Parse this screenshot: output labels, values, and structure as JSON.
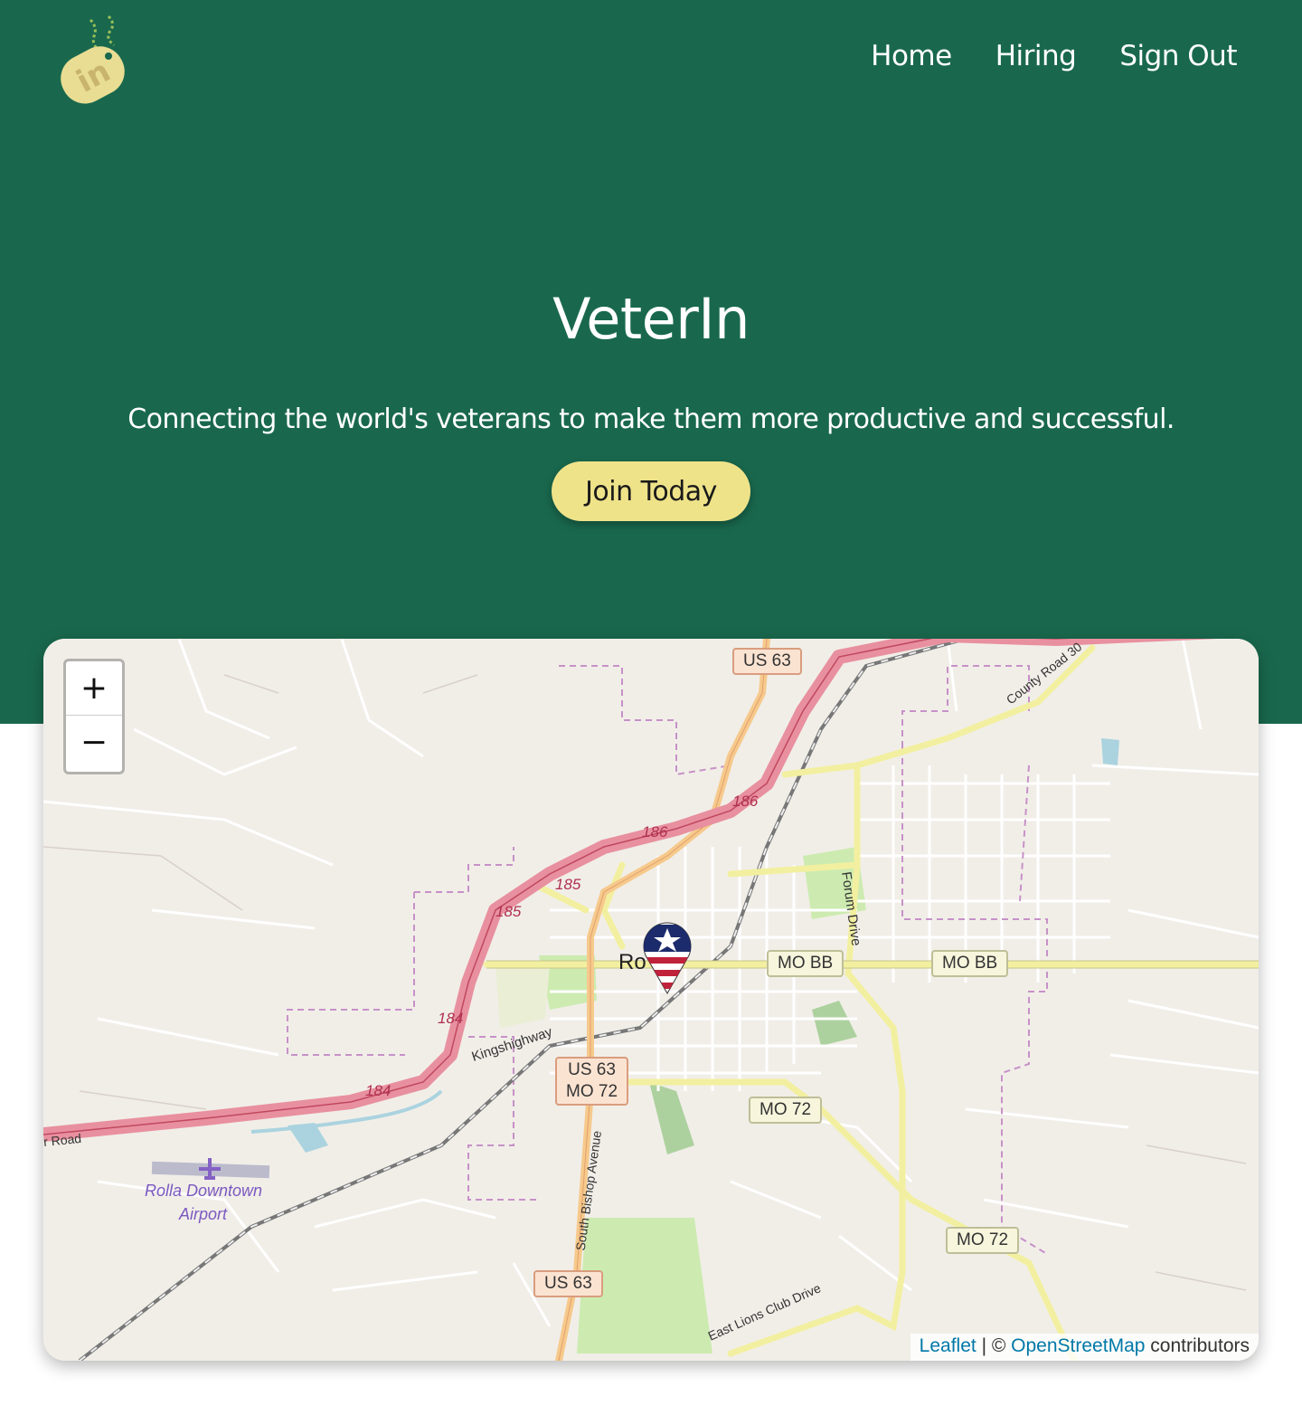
{
  "header": {
    "logo_icon": "dog-tag-logo-icon",
    "nav": [
      {
        "label": "Home"
      },
      {
        "label": "Hiring"
      },
      {
        "label": "Sign Out"
      }
    ]
  },
  "hero": {
    "title": "VeterIn",
    "tagline": "Connecting the world's veterans to make them more productive and successful.",
    "cta_label": "Join Today"
  },
  "colors": {
    "hero_bg": "#19684d",
    "cta_bg": "#efe38a",
    "map_bg": "#f1eee8",
    "highway": "#e8909f",
    "primary_road": "#f6c98c",
    "secondary_road": "#f2f0a0",
    "link": "#0078a8"
  },
  "map": {
    "zoom_in_label": "+",
    "zoom_out_label": "−",
    "marker_icon": "american-flag-pin-icon",
    "airport_icon": "airplane-icon",
    "attribution": {
      "leaflet": "Leaflet",
      "separator": " | © ",
      "osm": "OpenStreetMap",
      "suffix": " contributors"
    },
    "shields": [
      {
        "text": "US 63"
      },
      {
        "text": "MO BB"
      },
      {
        "text": "MO BB"
      },
      {
        "text": "US 63\nMO 72"
      },
      {
        "text": "MO 72"
      },
      {
        "text": "MO 72"
      },
      {
        "text": "US 63"
      }
    ],
    "labels": {
      "city": "Ro",
      "exit_186a": "186",
      "exit_186b": "186",
      "exit_185a": "185",
      "exit_185b": "185",
      "exit_184a": "184",
      "exit_184b": "184",
      "kingshighway": "Kingshighway",
      "forum_drive": "Forum Drive",
      "south_bishop": "South Bishop Avenue",
      "county_road": "County Road 30",
      "east_lions": "East Lions Club Drive",
      "road_west": "r Road",
      "airport_line1": "Rolla Downtown",
      "airport_line2": "Airport"
    }
  }
}
